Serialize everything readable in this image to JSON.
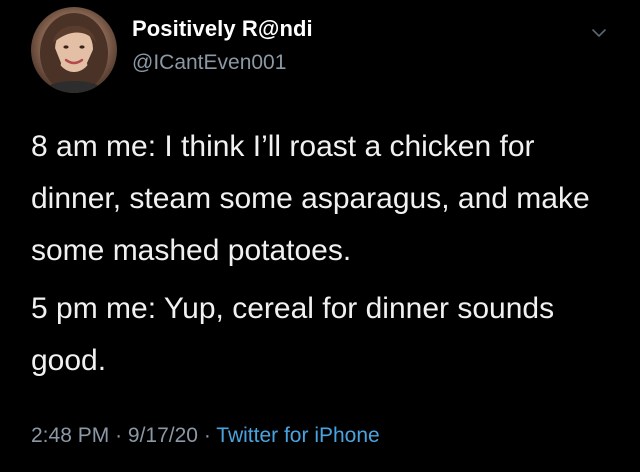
{
  "user": {
    "display_name": "Positively R@ndi",
    "handle": "@ICantEven001",
    "avatar_icon": "profile-photo"
  },
  "tweet": {
    "paragraphs": [
      "8 am me: I think I’ll roast a chicken for dinner, steam some asparagus, and make some mashed potatoes.",
      "5 pm me: Yup, cereal for dinner sounds good."
    ],
    "time": "2:48 PM",
    "date": "9/17/20",
    "separator": "·",
    "source": "Twitter for iPhone"
  },
  "menu": {
    "icon": "chevron-down-icon"
  },
  "colors": {
    "background": "#000000",
    "name": "#ffffff",
    "text": "#f1f1f1",
    "secondary": "#8b98a5",
    "link": "#4aa3df"
  }
}
